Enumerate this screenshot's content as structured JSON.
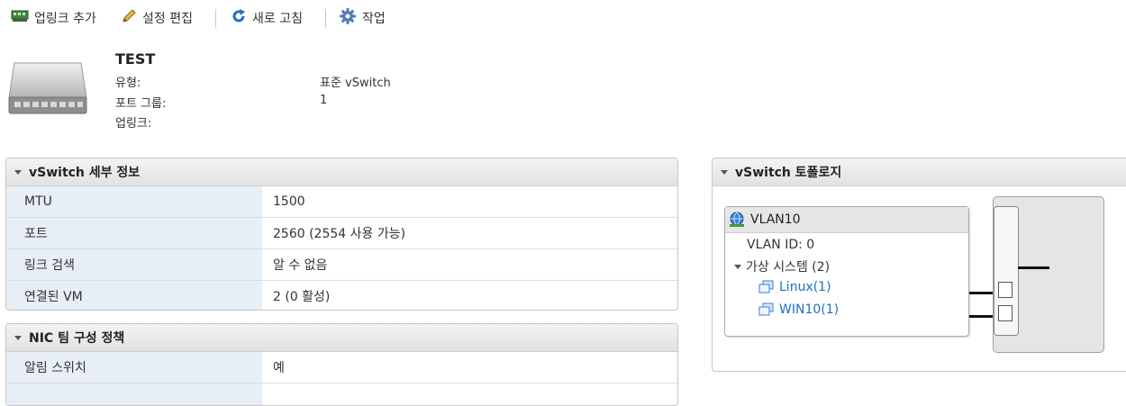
{
  "toolbar": {
    "add_uplink": "업링크 추가",
    "edit_settings": "설정 편집",
    "refresh": "새로 고침",
    "actions": "작업"
  },
  "header": {
    "title": "TEST",
    "type_label": "유형:",
    "type_value": "표준 vSwitch",
    "portgroups_label": "포트 그룹:",
    "portgroups_value": "1",
    "uplinks_label": "업링크:",
    "uplinks_value": ""
  },
  "details": {
    "title": "vSwitch 세부 정보",
    "rows": [
      {
        "key": "MTU",
        "value": "1500"
      },
      {
        "key": "포트",
        "value": "2560 (2554 사용 가능)"
      },
      {
        "key": "링크 검색",
        "value": "알 수 없음"
      },
      {
        "key": "연결된 VM",
        "value": "2 (0 활성)"
      }
    ]
  },
  "nic": {
    "title": "NIC 팀 구성 정책",
    "rows": [
      {
        "key": "알림 스위치",
        "value": "예"
      }
    ]
  },
  "topology": {
    "title": "vSwitch 토폴로지",
    "portgroup": {
      "name": "VLAN10",
      "vlan_id": "VLAN ID: 0",
      "vms_label": "가상 시스템 (2)",
      "vms": [
        "Linux(1)",
        "WIN10(1)"
      ]
    }
  },
  "colors": {
    "accent": "#1f6fbf",
    "key_bg": "#e7eef6",
    "panel_head": "#e2e2e2"
  }
}
